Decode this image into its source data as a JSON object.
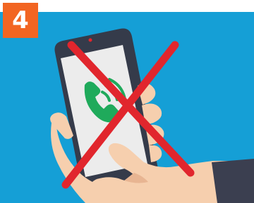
{
  "badge": {
    "number": "4"
  },
  "colors": {
    "panel_background": "#159fd6",
    "badge_background": "#f26522",
    "phone_body": "#353b4a",
    "phone_screen": "#ececec",
    "skin": "#f6cfae",
    "skin_shadow": "#e8b592",
    "sleeve": "#3b3f50",
    "call_icon": "#1faa5b",
    "cross": "#e1262d"
  },
  "icons": {
    "illustration": "hand-holding-phone-illustration",
    "call": "incoming-call-icon",
    "cross": "red-cross-mark-icon"
  }
}
